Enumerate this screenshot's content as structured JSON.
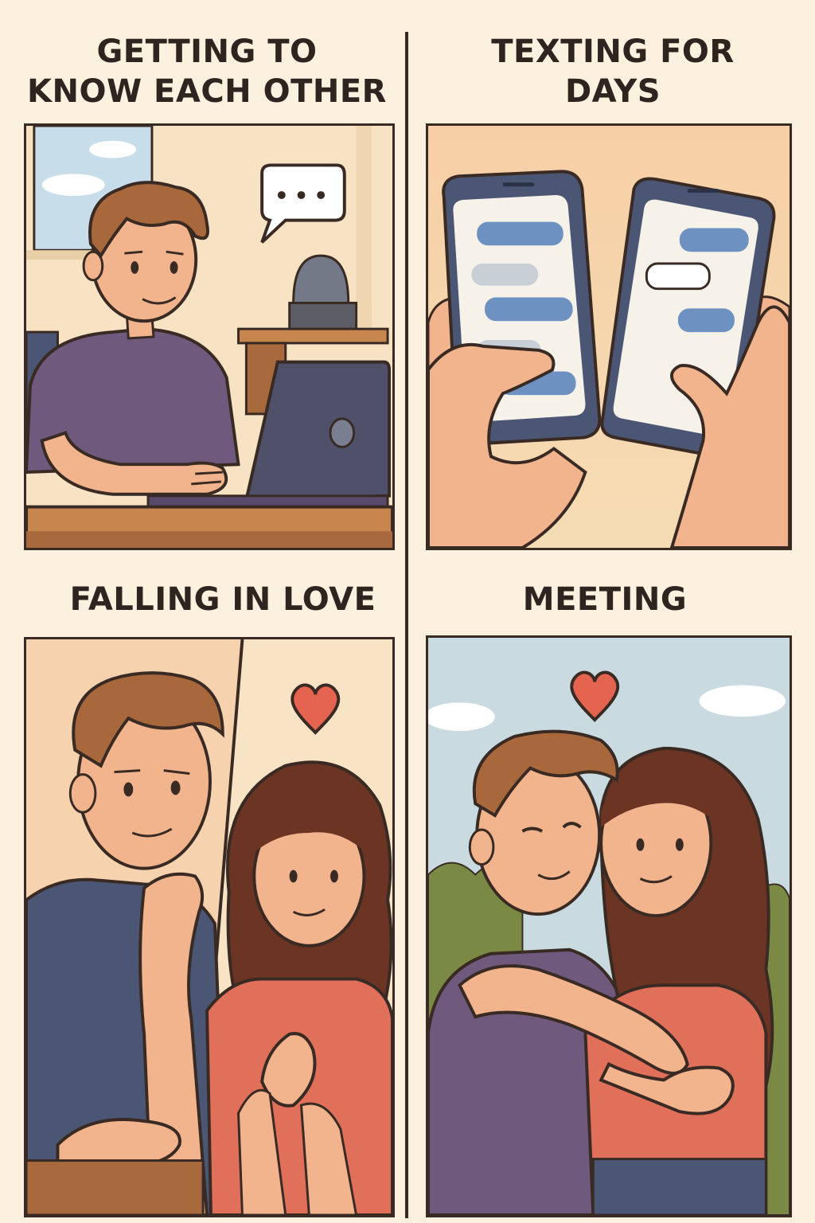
{
  "comic": {
    "panels": [
      {
        "title_line1": "GETTING TO",
        "title_line2": "KNOW EACH OTHER"
      },
      {
        "title_line1": "TEXTING FOR",
        "title_line2": "DAYS"
      },
      {
        "title_line1": "FALLING IN LOVE"
      },
      {
        "title_line1": "MEETING"
      }
    ]
  },
  "colors": {
    "background": "#fbf1de",
    "outline": "#3a2a24",
    "skin": "#f2b48c",
    "hair_male": "#a8683c",
    "hair_female": "#6b3423",
    "shirt_purple": "#6f5a7e",
    "shirt_blue": "#4b5675",
    "shirt_coral": "#e0705a",
    "heart": "#e4644f",
    "bubble_blue": "#6d92c2"
  },
  "icons": [
    "speech-bubble-icon",
    "laptop-icon",
    "phone-icon",
    "heart-icon"
  ]
}
